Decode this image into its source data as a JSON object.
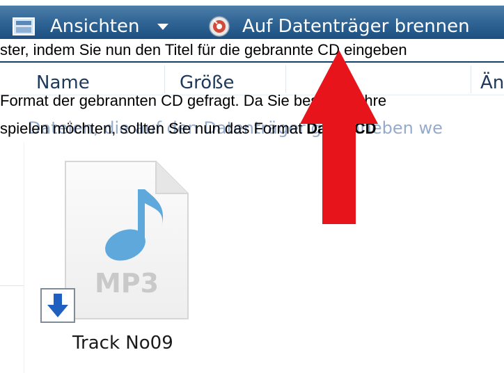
{
  "toolbar": {
    "views_label": "Ansichten",
    "burn_label": "Auf Datenträger brennen"
  },
  "columns": {
    "name": "Name",
    "size": "Größe",
    "date": "Än"
  },
  "caption": {
    "line1": "ster, indem Sie nun den Titel für die gebrannte CD eingeben",
    "line2": "Format der gebrannten CD gefragt. Da Sie bestimmt Ihre",
    "line3_prefix": "spielen möchten, sollten Sie nun das Format ",
    "line3_bold": "Daten-CD"
  },
  "ghost_text": "Dateien, die auf den Datenträger geschrieben we",
  "file": {
    "name": "Track No09",
    "badge": "MP3"
  },
  "colors": {
    "toolbar": "#1c4f80",
    "header_text": "#1e395b",
    "note_icon": "#5fa8dc",
    "arrow": "#e8141c",
    "shortcut_arrow": "#1f5fbf"
  },
  "icons": {
    "views": "views-icon",
    "dropdown": "chevron-down-icon",
    "burn": "burn-disc-icon",
    "music_note": "music-note-icon",
    "shortcut": "shortcut-arrow-icon",
    "pointer": "red-arrow"
  }
}
